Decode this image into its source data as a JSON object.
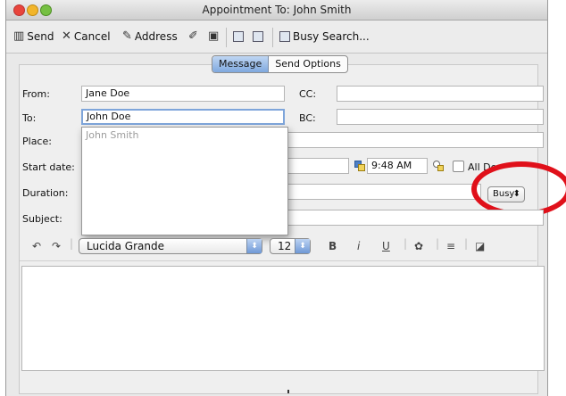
{
  "window": {
    "title": "Appointment To: John Smith"
  },
  "toolbar": {
    "send": "Send",
    "cancel": "Cancel",
    "address": "Address",
    "busy_search": "Busy Search..."
  },
  "tabs": {
    "message": "Message",
    "send_options": "Send Options"
  },
  "form": {
    "from_label": "From:",
    "from_value": "Jane Doe",
    "cc_label": "CC:",
    "cc_value": "",
    "to_label": "To:",
    "to_value": "John Doe",
    "bc_label": "BC:",
    "bc_value": "",
    "place_label": "Place:",
    "place_value": "",
    "start_date_label": "Start date:",
    "start_time": "9:48 AM",
    "all_day_label": "All De",
    "duration_label": "Duration:",
    "show_as": "Busy",
    "subject_label": "Subject:",
    "subject_value": ""
  },
  "autocomplete": {
    "items": [
      "John Smith"
    ]
  },
  "format_bar": {
    "font": "Lucida Grande",
    "size": "12",
    "bold": "B",
    "italic": "i",
    "underline": "U"
  },
  "colors": {
    "highlight_ring": "#e0101a",
    "accent": "#7fa8de"
  }
}
